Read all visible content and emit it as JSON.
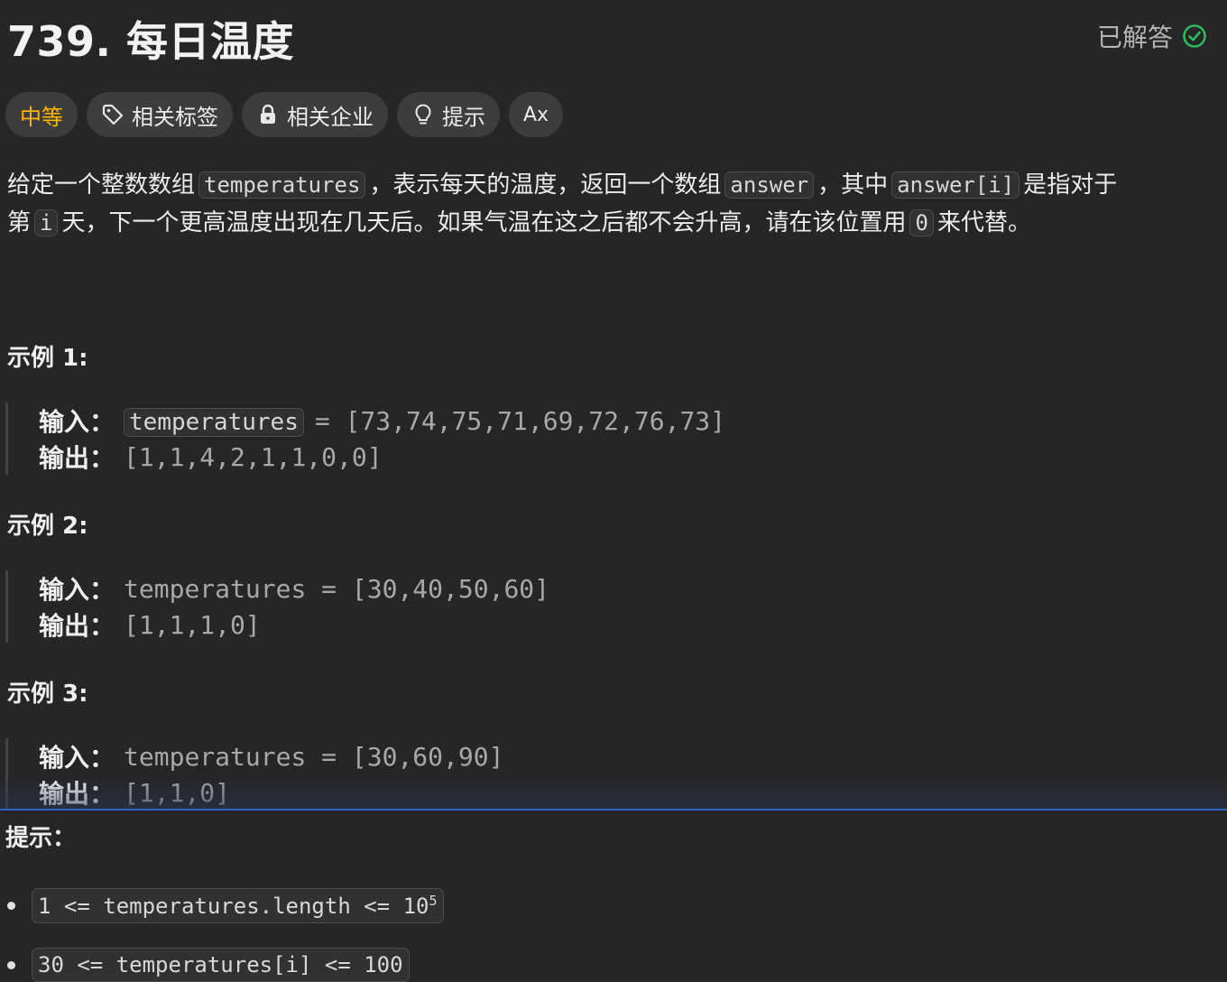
{
  "header": {
    "title": "739. 每日温度",
    "status_label": "已解答",
    "status_color": "#2cbb5d"
  },
  "tags": [
    {
      "label": "中等",
      "icon": "",
      "color": "#ffb800"
    },
    {
      "label": "相关标签",
      "icon": "tag-icon"
    },
    {
      "label": "相关企业",
      "icon": "lock-icon"
    },
    {
      "label": "提示",
      "icon": "lightbulb-icon"
    },
    {
      "label": "Ax",
      "icon": "translate-icon"
    }
  ],
  "description": {
    "p1_a": "给定一个整数数组",
    "code_temperatures": "temperatures",
    "p1_b": "，表示每天的温度，返回一个数组",
    "code_answer": "answer",
    "p1_c": "，其中",
    "code_answer_i": "answer[i]",
    "p1_d": "是指对于",
    "p2_a": "第",
    "code_i": "i",
    "p2_b": "天，下一个更高温度出现在几天后。如果气温在这之后都不会升高，请在该位置用",
    "code_zero": "0",
    "p2_c": "来代替。"
  },
  "examples": [
    {
      "title": "示例 1:",
      "input_label": "输入：",
      "input_code": "temperatures",
      "input_rest": "= [73,74,75,71,69,72,76,73]",
      "output_label": "输出：",
      "output_value": "[1,1,4,2,1,1,0,0]"
    },
    {
      "title": "示例 2:",
      "input_label": "输入：",
      "input_value": "temperatures = [30,40,50,60]",
      "output_label": "输出：",
      "output_value": "[1,1,1,0]"
    },
    {
      "title": "示例 3:",
      "input_label": "输入：",
      "input_value": "temperatures = [30,60,90]",
      "output_label": "输出：",
      "output_value": "[1,1,0]"
    }
  ],
  "hints": {
    "title": "提示：",
    "constraint_1_base": "1 <= temperatures.length <= 10",
    "constraint_1_exp": "5",
    "constraint_2": "30 <= temperatures[i] <= 100"
  }
}
